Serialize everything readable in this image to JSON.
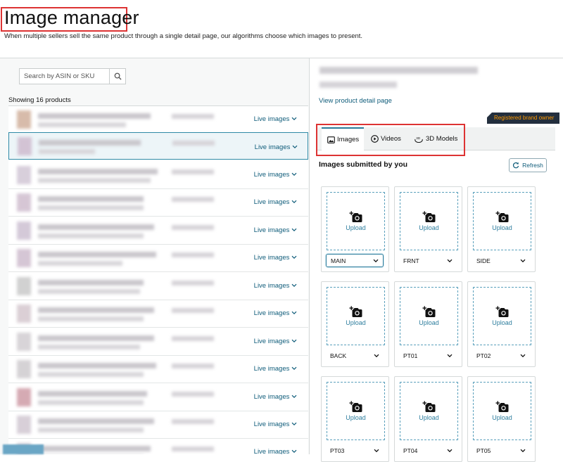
{
  "header": {
    "title": "Image manager",
    "subtitle": "When multiple sellers sell the same product through a single detail page, our algorithms choose which images to present."
  },
  "search": {
    "placeholder": "Search by ASIN or SKU"
  },
  "products": {
    "count_label": "Showing 16 products",
    "live_label": "Live images",
    "selected_index": 1,
    "thumb_colors": [
      "#caa58e",
      "#cbb3c9",
      "#cbbfd0",
      "#c9b4c8",
      "#c6b8cc",
      "#c8b3c7",
      "#c2c2c2",
      "#cfc0c8",
      "#cbc6cb",
      "#c8c4c8",
      "#c88e9a",
      "#cbc0cc",
      "#c7c0cb"
    ]
  },
  "detail": {
    "view_link": "View product detail page",
    "brand_badge": "Registered brand owner",
    "tabs": [
      "Images",
      "Videos",
      "3D Models"
    ],
    "active_tab": "Images",
    "submitted_heading": "Images submitted by you",
    "refresh_label": "Refresh",
    "upload_label": "Upload",
    "slots": [
      "MAIN",
      "FRNT",
      "SIDE",
      "BACK",
      "PT01",
      "PT02",
      "PT03",
      "PT04",
      "PT05"
    ]
  },
  "colors": {
    "link": "#0f5c7a",
    "accent": "#2b7a99",
    "badge_bg": "#232f3e",
    "badge_text": "#ff9900",
    "highlight": "#dd3333"
  }
}
